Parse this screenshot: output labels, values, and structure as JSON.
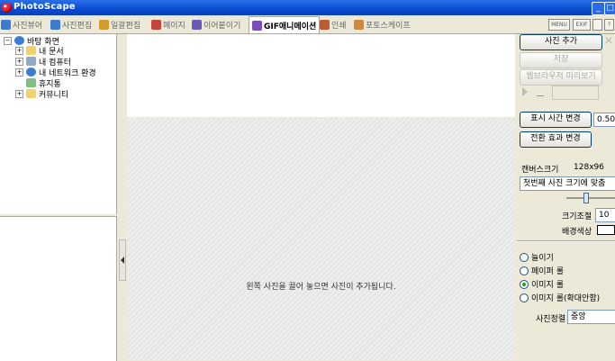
{
  "window": {
    "title": "PhotoScape"
  },
  "tabs": [
    {
      "label": "사진뷰어",
      "color": "#3b7bd0"
    },
    {
      "label": "사진편집",
      "color": "#3b7bd0"
    },
    {
      "label": "일괄편집",
      "color": "#d29b2a"
    },
    {
      "label": "페이지",
      "color": "#c4453c"
    },
    {
      "label": "이어붙이기",
      "color": "#6a59b8"
    },
    {
      "label": "GIF애니메이션",
      "color": "#7a4cc0"
    },
    {
      "label": "인쇄",
      "color": "#c05a30"
    },
    {
      "label": "포토스케이프",
      "color": "#d0883a"
    }
  ],
  "active_tab_index": 5,
  "toolbar_icons": [
    "MENU",
    "EXIF",
    "",
    "?"
  ],
  "tree": {
    "items": [
      {
        "label": "바탕 화면",
        "expander": "⊟",
        "icon": "desktop-icon"
      },
      {
        "label": "내 문서",
        "expander": "⊞",
        "icon": "folder-icon"
      },
      {
        "label": "내 컴퓨터",
        "expander": "⊞",
        "icon": "computer-icon"
      },
      {
        "label": "내 네트워크 환경",
        "expander": "⊞",
        "icon": "network-icon"
      },
      {
        "label": "휴지통",
        "expander": "",
        "icon": "recycle-bin-icon"
      },
      {
        "label": "커뮤니티",
        "expander": "⊞",
        "icon": "folder-icon"
      }
    ]
  },
  "canvas": {
    "hint": "왼쪽 사진을 끌어 놓으면 사진이 추가됩니다."
  },
  "right": {
    "add_photo": "사진 추가",
    "save": "저장",
    "browser_preview": "웹브라우저 미리보기",
    "display_time_btn": "표시 시간 변경",
    "display_time_value": "0.50",
    "transition_btn": "전환 효과 변경",
    "canvas_size_label": "캔버스크기",
    "canvas_size_value": "128x96",
    "fit_select": "첫번째 사진 크기에 맞춤",
    "scale_label": "크기조절",
    "scale_value": "10",
    "bg_color_label": "배경색상",
    "bg_color": "#ffffff",
    "radios": [
      {
        "label": "늘이기",
        "checked": false
      },
      {
        "label": "페이퍼 롤",
        "checked": false
      },
      {
        "label": "이미지 롤",
        "checked": true
      },
      {
        "label": "이미지 롤(확대안함)",
        "checked": false
      }
    ],
    "align_label": "사진정렬",
    "align_value": "중앙"
  }
}
